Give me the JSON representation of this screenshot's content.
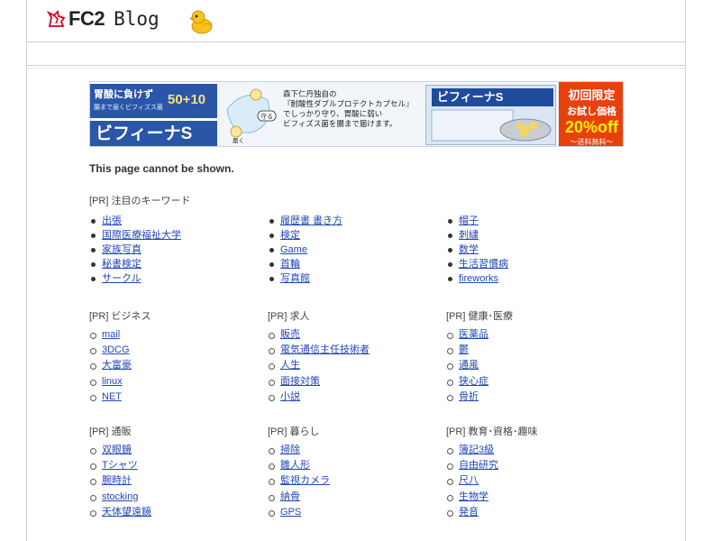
{
  "header": {
    "logo_text": "FC2",
    "blog_text": "Blog"
  },
  "banner": {
    "tag_line1": "胃酸に負けず",
    "tag_line2": "腸まで届くビフィズス菌",
    "tag_number": "50+10",
    "brand": "ビフィーナS",
    "copy": [
      "森下仁丹独自の",
      "『耐酸性ダブルプロテクトカプセル』",
      "でしっかり守り、胃酸に弱い",
      "ビフィズス菌を腸まで届けます。"
    ],
    "mid_label1": "守る",
    "mid_label2": "届く",
    "offer_line1": "初回限定",
    "offer_line2": "お試し価格",
    "offer_line3": "20%off",
    "offer_line4": "～送料無料～"
  },
  "message": "This page cannot be shown.",
  "featured": {
    "title": "[PR] 注目のキーワード",
    "columns": [
      [
        "出張",
        "国際医療福祉大学",
        "家族写真",
        "秘書検定",
        "サークル"
      ],
      [
        "履歴書 書き方",
        "検定",
        "Game",
        "首輪",
        "写真館"
      ],
      [
        "帽子",
        "刺繍",
        "数学",
        "生活習慣病",
        "fireworks"
      ]
    ]
  },
  "categories": [
    {
      "title": "[PR] ビジネス",
      "items": [
        "mail",
        "3DCG",
        "大富豪",
        "linux",
        "NET"
      ]
    },
    {
      "title": "[PR] 求人",
      "items": [
        "販売",
        "電気通信主任技術者",
        "人生",
        "面接対策",
        "小説"
      ]
    },
    {
      "title": "[PR] 健康･医療",
      "items": [
        "医薬品",
        "鬱",
        "通風",
        "狭心症",
        "骨折"
      ]
    },
    {
      "title": "[PR] 通販",
      "items": [
        "双眼鏡",
        "Tシャツ",
        "腕時計",
        "stocking",
        "天体望遠鏡"
      ]
    },
    {
      "title": "[PR] 暮らし",
      "items": [
        "掃除",
        "雛人形",
        "監視カメラ",
        "納骨",
        "GPS"
      ]
    },
    {
      "title": "[PR] 教育･資格･趣味",
      "items": [
        "簿記3級",
        "自由研究",
        "尺八",
        "生物学",
        "発音"
      ]
    }
  ]
}
